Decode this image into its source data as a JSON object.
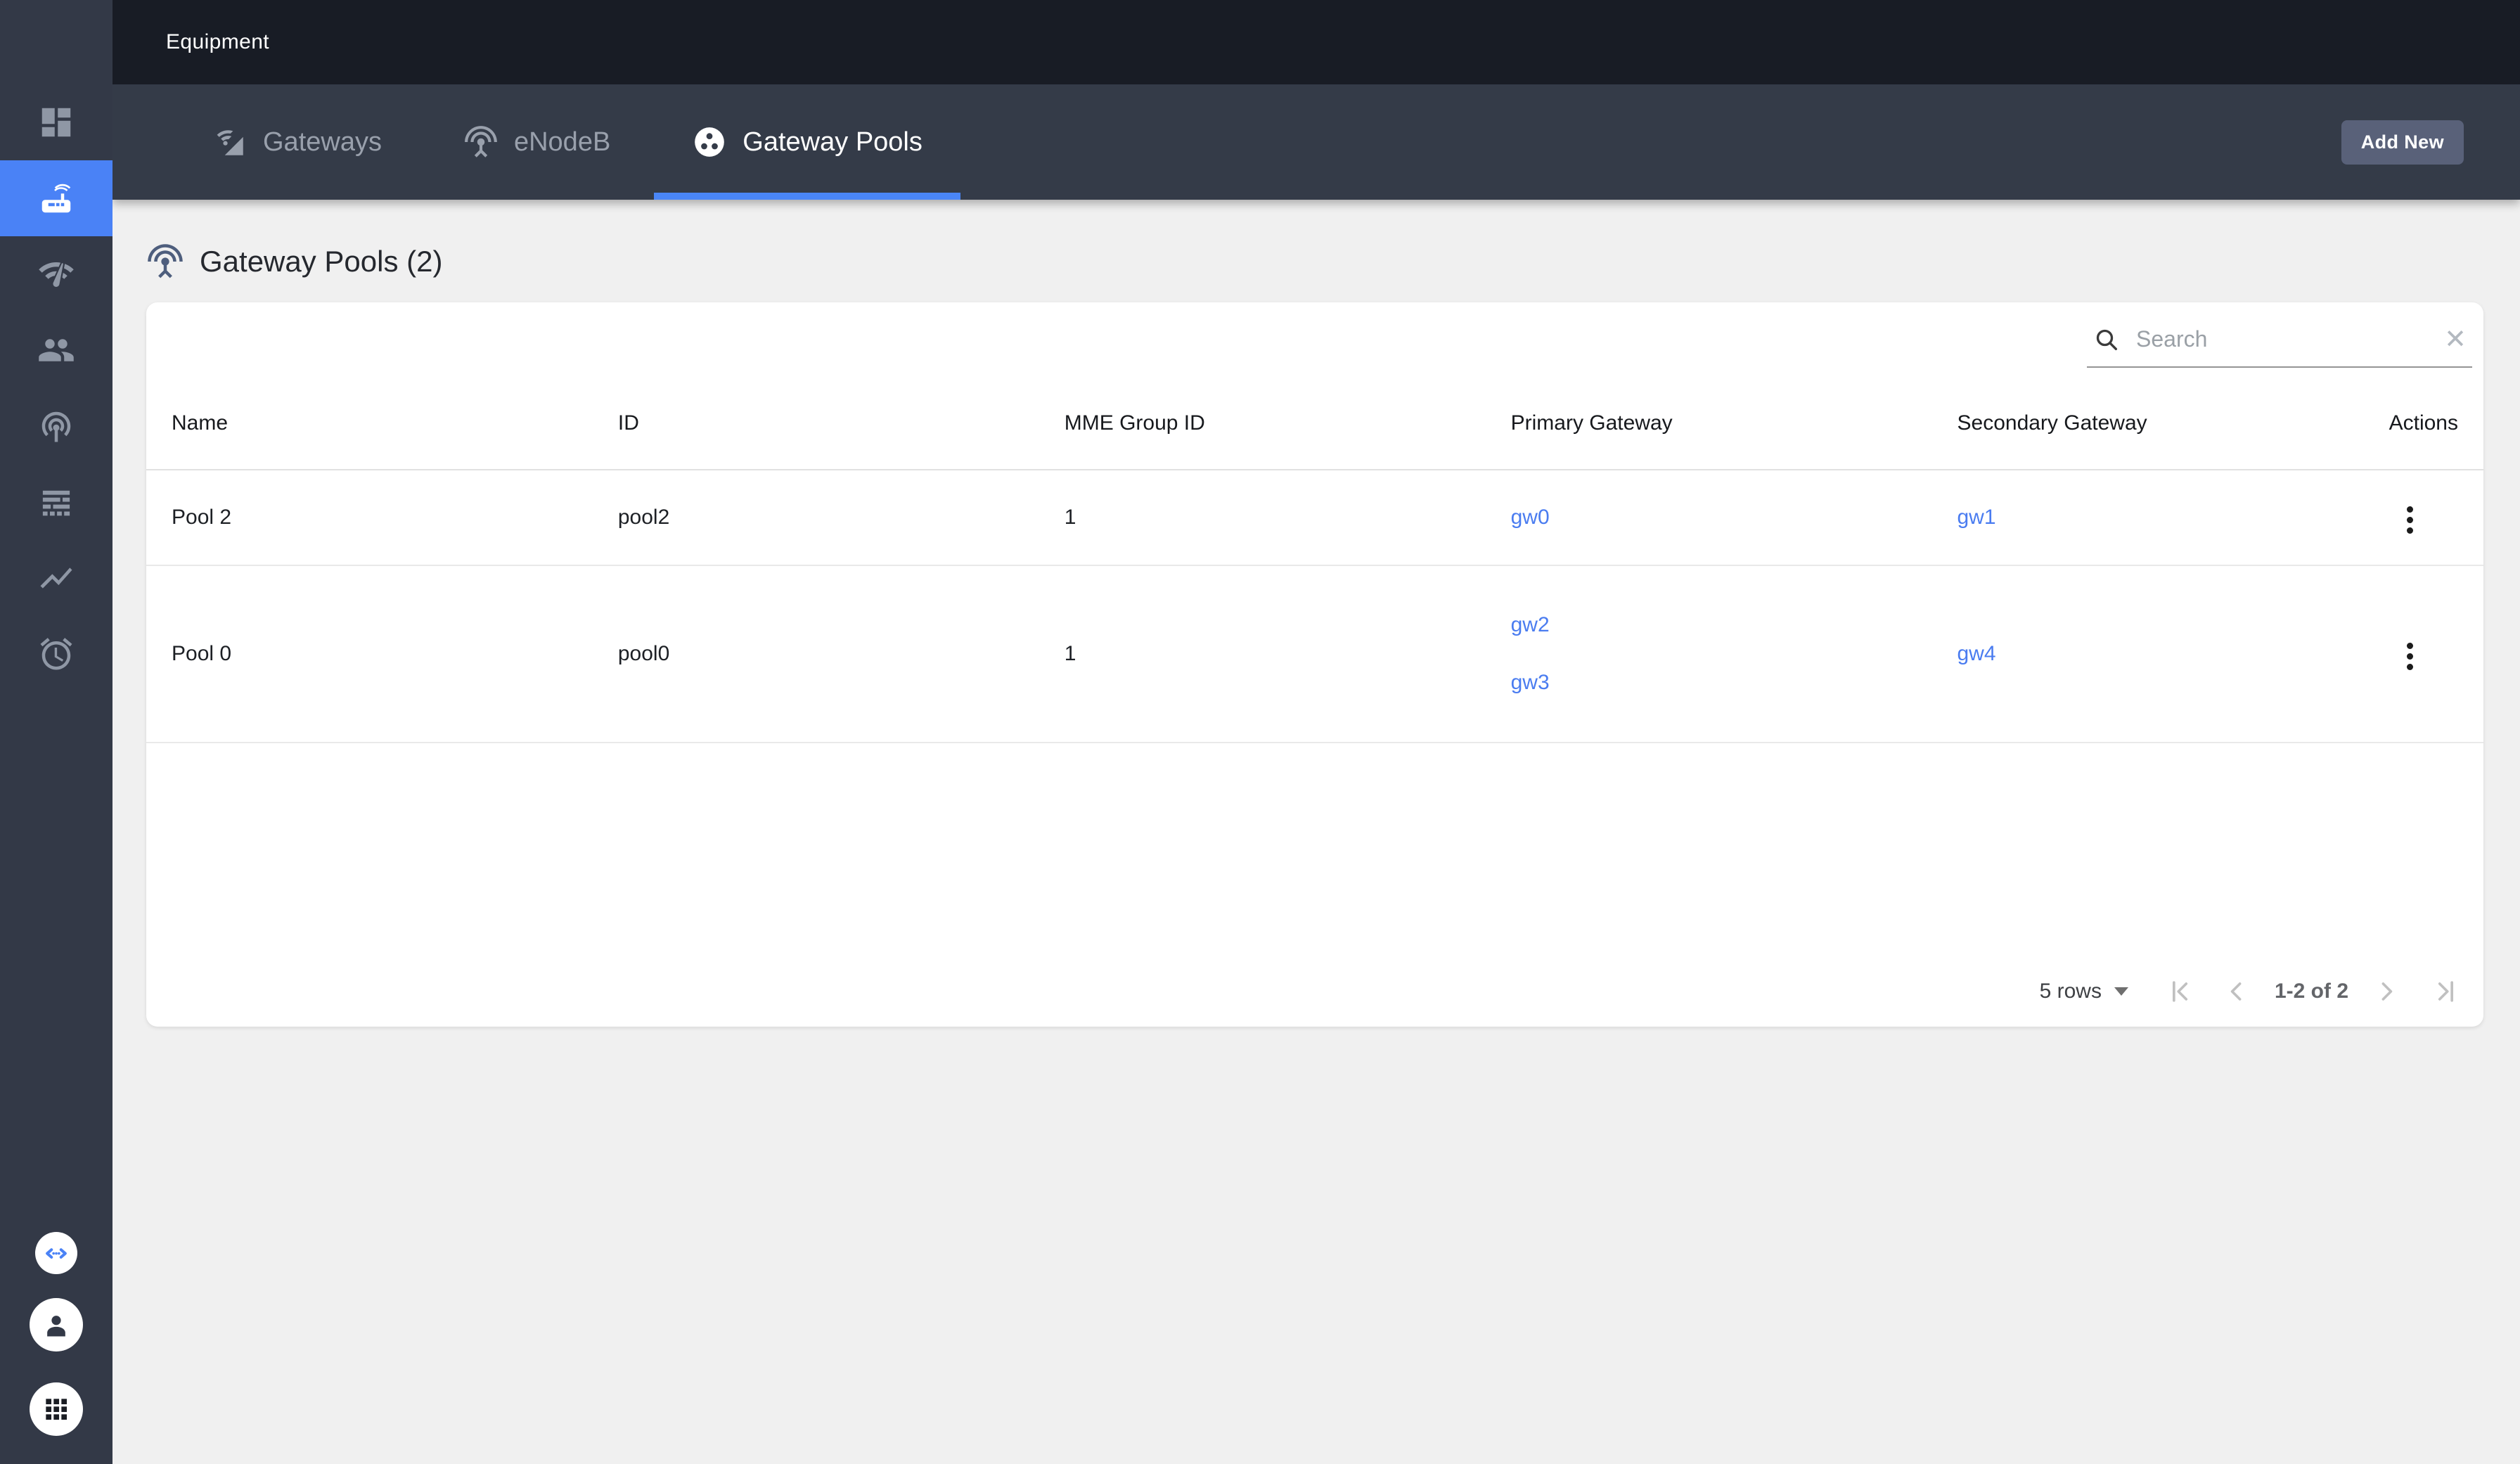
{
  "topbar": {
    "title": "Equipment"
  },
  "tabbar": {
    "tabs": [
      {
        "label": "Gateways",
        "icon": "cell-wifi-icon"
      },
      {
        "label": "eNodeB",
        "icon": "antenna-icon"
      },
      {
        "label": "Gateway Pools",
        "icon": "group-work-icon"
      }
    ],
    "active_tab": "Gateway Pools",
    "add_new_label": "Add New"
  },
  "sidebar": {
    "items": [
      {
        "name": "dashboard",
        "icon": "dashboard-icon",
        "active": false
      },
      {
        "name": "equipment",
        "icon": "router-icon",
        "active": true
      },
      {
        "name": "network",
        "icon": "network-check-icon",
        "active": false
      },
      {
        "name": "subscribers",
        "icon": "people-icon",
        "active": false
      },
      {
        "name": "tethering",
        "icon": "wifi-tethering-icon",
        "active": false
      },
      {
        "name": "logs",
        "icon": "logs-icon",
        "active": false
      },
      {
        "name": "metrics",
        "icon": "chart-icon",
        "active": false
      },
      {
        "name": "alerts",
        "icon": "alarm-icon",
        "active": false
      }
    ],
    "footer_items": [
      {
        "name": "api",
        "icon": "code-icon"
      },
      {
        "name": "account",
        "icon": "person-icon"
      },
      {
        "name": "apps",
        "icon": "apps-grid-icon"
      }
    ]
  },
  "main": {
    "heading": "Gateway Pools (2)",
    "heading_icon": "antenna-icon"
  },
  "search": {
    "placeholder": "Search"
  },
  "table": {
    "columns": [
      "Name",
      "ID",
      "MME Group ID",
      "Primary Gateway",
      "Secondary Gateway",
      "Actions"
    ],
    "rows": [
      {
        "name": "Pool 2",
        "id": "pool2",
        "mme_group_id": "1",
        "primary_gateways": [
          "gw0"
        ],
        "secondary_gateways": [
          "gw1"
        ]
      },
      {
        "name": "Pool 0",
        "id": "pool0",
        "mme_group_id": "1",
        "primary_gateways": [
          "gw2",
          "gw3"
        ],
        "secondary_gateways": [
          "gw4"
        ]
      }
    ]
  },
  "pagination": {
    "rows_per_page_label": "5 rows",
    "range_label": "1-2 of 2"
  },
  "colors": {
    "accent_blue": "#4a82f6",
    "link_blue": "#4a7cf0",
    "topbar_bg": "#181c25",
    "tabbar_bg": "#343b48",
    "sidebar_bg": "#333947",
    "page_bg": "#f0f0f0"
  }
}
